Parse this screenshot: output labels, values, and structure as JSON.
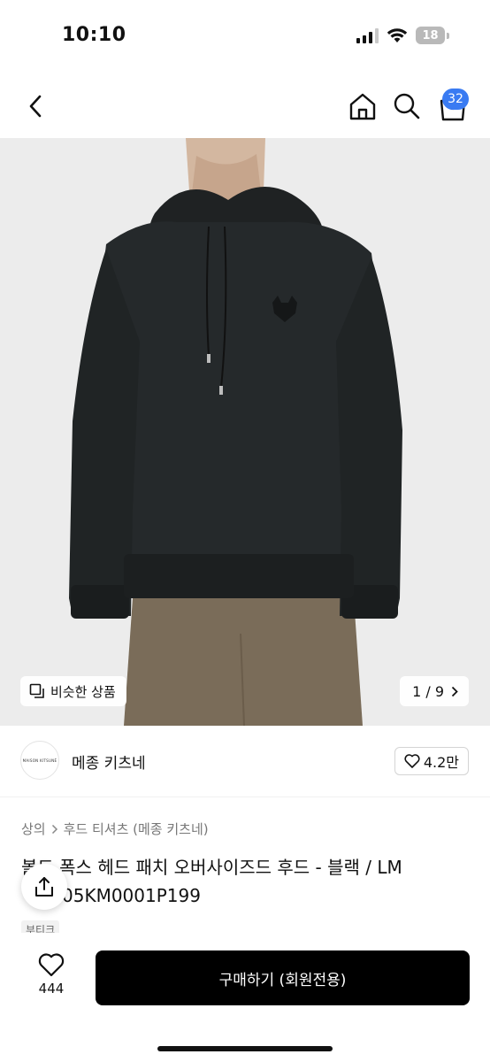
{
  "status_bar": {
    "time": "10:10",
    "battery": "18"
  },
  "nav": {
    "cart_count": "32",
    "icons": [
      "chevron-left-icon",
      "home-icon",
      "search-icon",
      "cart-icon"
    ]
  },
  "gallery": {
    "similar_label": "비슷한 상품",
    "page_indicator": "1 / 9"
  },
  "brand": {
    "logo_text": "MAISON KITSUNÉ",
    "name": "메종 키츠네",
    "likes": "4.2만"
  },
  "breadcrumb": {
    "category": "상의",
    "subcategory": "후드 티셔츠 (메종 키츠네)"
  },
  "product": {
    "title_line1": "볼드 폭스 헤드 패치 오버사이즈드 후드 - 블랙 / LM",
    "title_line2": "05KM0001P199",
    "tag": "부티크"
  },
  "bottom_bar": {
    "wish_count": "444",
    "buy_label": "구매하기 (회원전용)"
  }
}
